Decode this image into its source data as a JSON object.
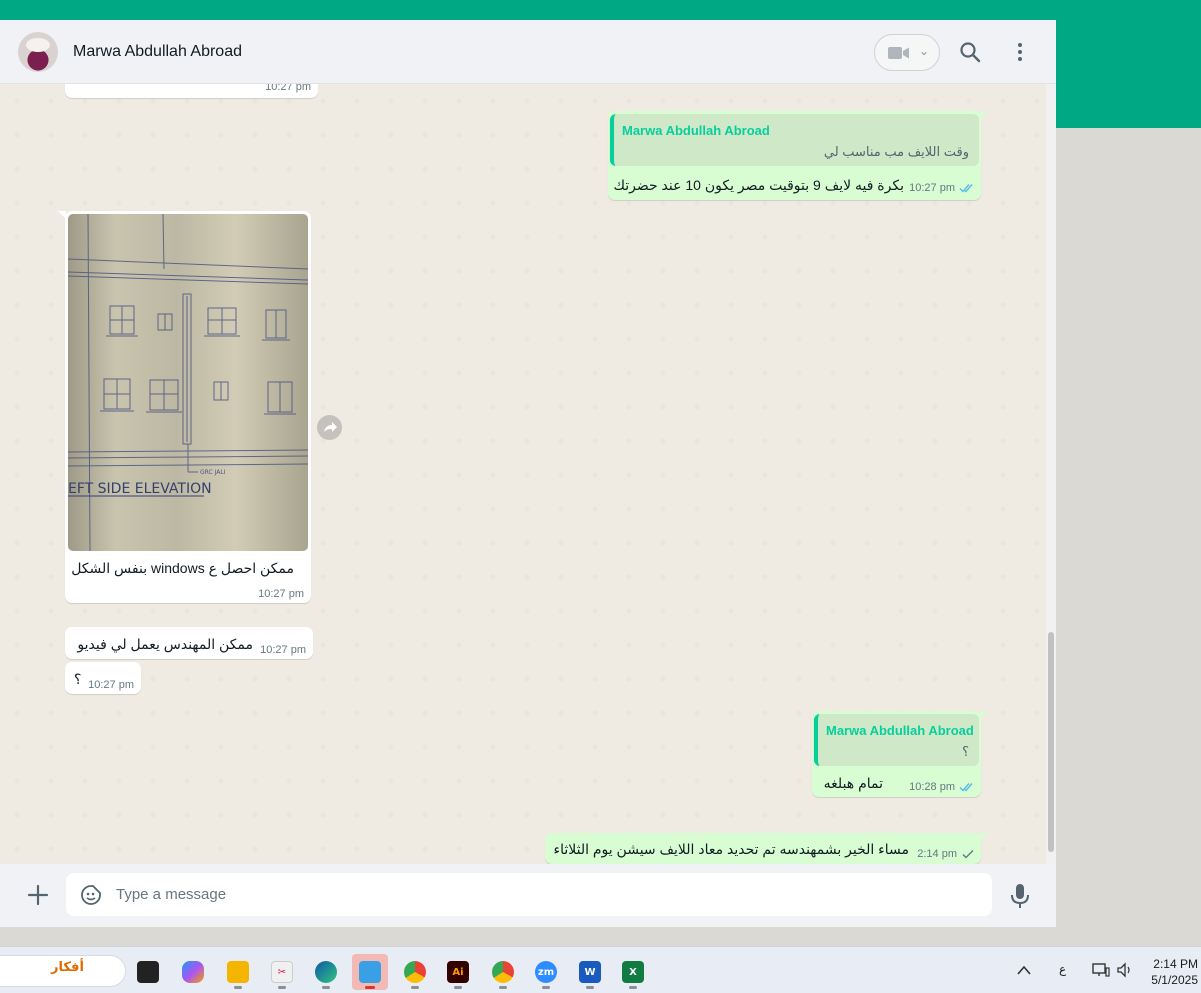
{
  "header": {
    "contact_name": "Marwa Abdullah Abroad"
  },
  "messages": {
    "top_partial_time": "10:27 pm",
    "m1": {
      "quote_name": "Marwa Abdullah Abroad",
      "quote_text": "وقت اللايف مب مناسب لي",
      "text": "بكرة فيه لايف 9 بتوقيت مصر يكون 10 عند حضرتك",
      "time": "10:27 pm"
    },
    "m2": {
      "photo_caption": "EFT SIDE ELEVATION",
      "photo_note": "GRC JALI",
      "text": "ممكن احصل ع windows بنفس الشكل",
      "time": "10:27 pm"
    },
    "m3": {
      "text": "ممكن المهندس يعمل لي فيديو",
      "time": "10:27 pm"
    },
    "m4": {
      "text": "؟",
      "time": "10:27 pm"
    },
    "m5": {
      "quote_name": "Marwa Abdullah Abroad",
      "quote_text": "؟",
      "text": "تمام هبلغه",
      "time": "10:28 pm"
    },
    "m6": {
      "text": "مساء الخير بشمهندسه تم تحديد معاد اللايف سيشن يوم الثلاثاء",
      "time": "2:14 pm"
    }
  },
  "composer": {
    "placeholder": "Type a message"
  },
  "taskbar": {
    "search_art": "أفكار",
    "apps": [
      "task-view",
      "copilot",
      "file-explorer",
      "snipping-tool",
      "edge",
      "notepad",
      "chrome",
      "illustrator",
      "chrome-profile",
      "zoom",
      "word",
      "excel"
    ],
    "language_indicator": "ع",
    "time": "2:14 PM",
    "date": "5/1/2025"
  },
  "colors": {
    "accent": "#00a884",
    "outgoing_bubble": "#d9fdd3",
    "incoming_bubble": "#ffffff",
    "read_ticks": "#53bdeb"
  }
}
